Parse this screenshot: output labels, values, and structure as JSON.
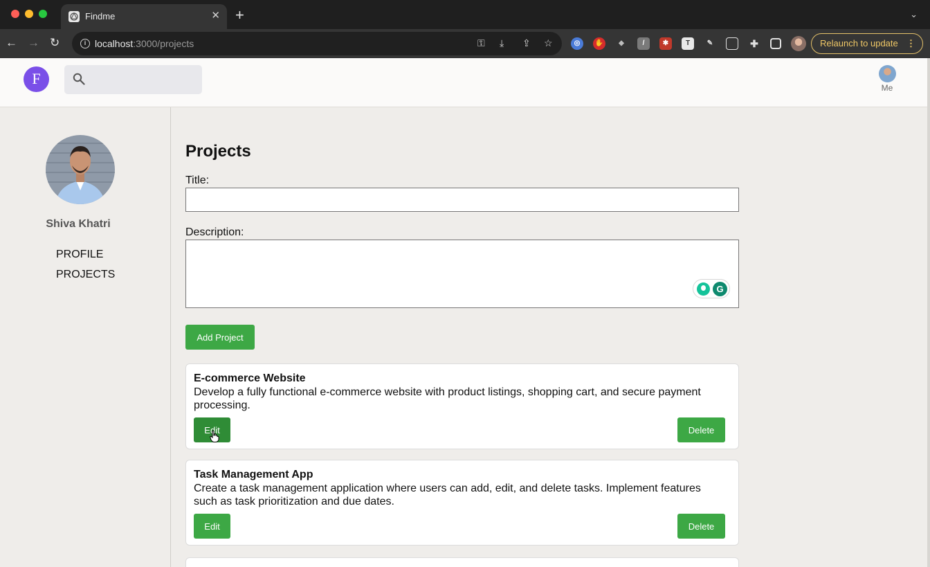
{
  "browser": {
    "tab_title": "Findme",
    "url_host": "localhost",
    "url_path": ":3000/projects",
    "relaunch_label": "Relaunch to update"
  },
  "header": {
    "logo_letter": "F",
    "search_placeholder": "",
    "me_label": "Me"
  },
  "sidebar": {
    "profile_name": "Shiva Khatri",
    "nav": [
      {
        "label": "PROFILE"
      },
      {
        "label": "PROJECTS"
      }
    ]
  },
  "main": {
    "title": "Projects",
    "form": {
      "title_label": "Title:",
      "title_value": "",
      "description_label": "Description:",
      "description_value": "",
      "add_button": "Add Project"
    },
    "projects": [
      {
        "title": "E-commerce Website",
        "description": "Develop a fully functional e-commerce website with product listings, shopping cart, and secure payment processing.",
        "edit_label": "Edit",
        "delete_label": "Delete"
      },
      {
        "title": "Task Management App",
        "description": "Create a task management application where users can add, edit, and delete tasks. Implement features such as task prioritization and due dates.",
        "edit_label": "Edit",
        "delete_label": "Delete"
      }
    ]
  },
  "colors": {
    "accent_green": "#3da845",
    "logo_purple": "#7a4fe8",
    "relaunch_yellow": "#f0c866"
  }
}
